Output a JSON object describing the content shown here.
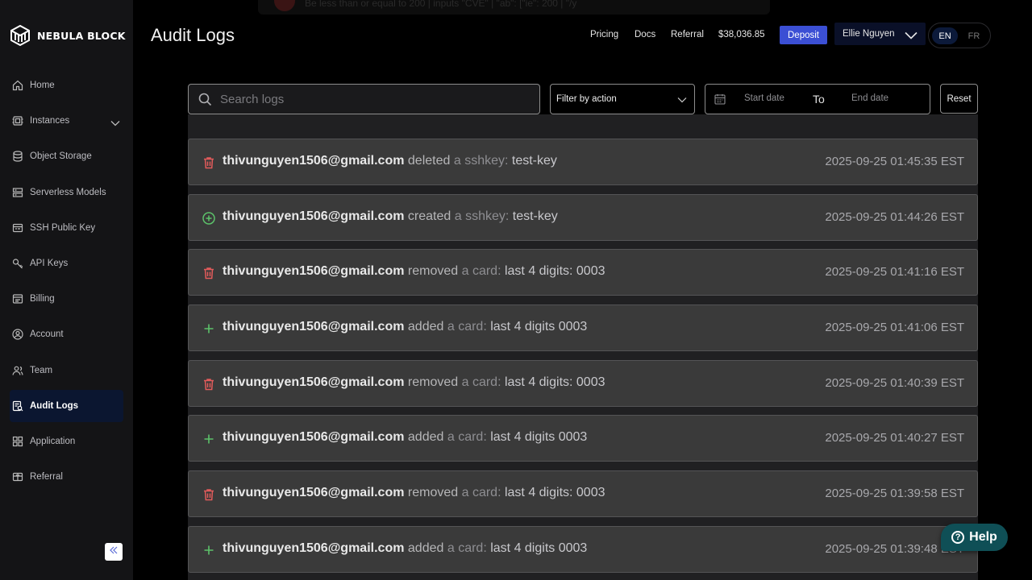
{
  "brand": {
    "name": "NEBULA BLOCK"
  },
  "sidebar": {
    "items": [
      {
        "label": "Home",
        "icon": "home-icon",
        "active": false
      },
      {
        "label": "Instances",
        "icon": "instances-icon",
        "active": false,
        "expandable": true
      },
      {
        "label": "Object Storage",
        "icon": "database-icon",
        "active": false
      },
      {
        "label": "Serverless Models",
        "icon": "server-icon",
        "active": false
      },
      {
        "label": "SSH Public Key",
        "icon": "ssh-key-icon",
        "active": false
      },
      {
        "label": "API Keys",
        "icon": "key-icon",
        "active": false
      },
      {
        "label": "Billing",
        "icon": "billing-icon",
        "active": false
      },
      {
        "label": "Account",
        "icon": "account-icon",
        "active": false
      },
      {
        "label": "Team",
        "icon": "team-icon",
        "active": false
      },
      {
        "label": "Audit Logs",
        "icon": "audit-logs-icon",
        "active": true
      },
      {
        "label": "Application",
        "icon": "application-icon",
        "active": false
      },
      {
        "label": "Referral",
        "icon": "referral-icon",
        "active": false
      }
    ]
  },
  "header": {
    "title": "Audit Logs",
    "banner_text": "Be less than or equal to 200 | inputs \"CVE\" | \"ab\": [\"ie\": 200 | \"/y",
    "nav": [
      "Pricing",
      "Docs",
      "Referral"
    ],
    "balance": "$38,036.85",
    "deposit_label": "Deposit",
    "user_name": "Ellie Nguyen",
    "lang": {
      "en": "EN",
      "fr": "FR",
      "selected": "EN"
    }
  },
  "filters": {
    "search_placeholder": "Search logs",
    "search_value": "",
    "action_select": "Filter by action",
    "start_date_placeholder": "Start date",
    "to_label": "To",
    "end_date_placeholder": "End date",
    "reset_label": "Reset"
  },
  "logs": [
    {
      "email": "thivunguyen1506@gmail.com",
      "action": "deleted",
      "entity": "a sshkey:",
      "detail": "test-key",
      "time": "2025-09-25 01:45:35 EST",
      "icon": "trash-icon"
    },
    {
      "email": "thivunguyen1506@gmail.com",
      "action": "created",
      "entity": "a sshkey:",
      "detail": "test-key",
      "time": "2025-09-25 01:44:26 EST",
      "icon": "plus-circle-icon"
    },
    {
      "email": "thivunguyen1506@gmail.com",
      "action": "removed",
      "entity": "a card:",
      "detail": "last 4 digits: 0003",
      "time": "2025-09-25 01:41:16 EST",
      "icon": "trash-icon"
    },
    {
      "email": "thivunguyen1506@gmail.com",
      "action": "added",
      "entity": "a card:",
      "detail": "last 4 digits 0003",
      "time": "2025-09-25 01:41:06 EST",
      "icon": "plus-icon"
    },
    {
      "email": "thivunguyen1506@gmail.com",
      "action": "removed",
      "entity": "a card:",
      "detail": "last 4 digits: 0003",
      "time": "2025-09-25 01:40:39 EST",
      "icon": "trash-icon"
    },
    {
      "email": "thivunguyen1506@gmail.com",
      "action": "added",
      "entity": "a card:",
      "detail": "last 4 digits 0003",
      "time": "2025-09-25 01:40:27 EST",
      "icon": "plus-icon"
    },
    {
      "email": "thivunguyen1506@gmail.com",
      "action": "removed",
      "entity": "a card:",
      "detail": "last 4 digits: 0003",
      "time": "2025-09-25 01:39:58 EST",
      "icon": "trash-icon"
    },
    {
      "email": "thivunguyen1506@gmail.com",
      "action": "added",
      "entity": "a card:",
      "detail": "last 4 digits 0003",
      "time": "2025-09-25 01:39:48 EST",
      "icon": "plus-icon"
    }
  ],
  "help": {
    "label": "Help"
  },
  "colors": {
    "accent": "#3b4fd4",
    "delete_red": "#e25b5b",
    "add_green": "#5cc26a",
    "sidebar_bg": "#141416",
    "row_bg": "#3a3a3a"
  }
}
